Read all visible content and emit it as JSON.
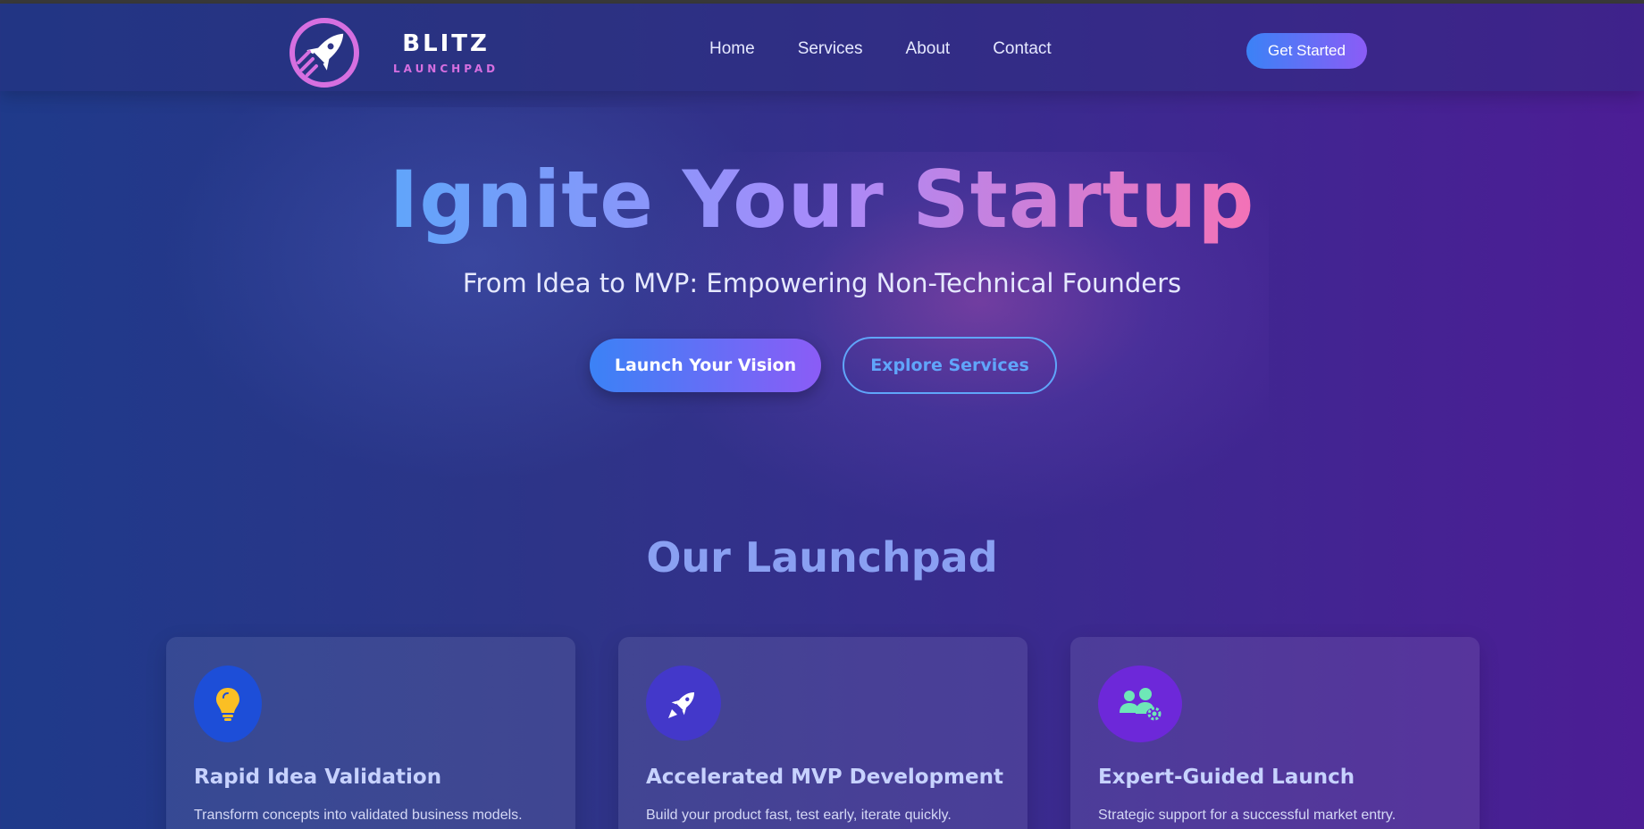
{
  "brand": {
    "name": "BLITZ",
    "tagline": "LAUNCHPAD"
  },
  "nav": {
    "items": [
      {
        "label": "Home"
      },
      {
        "label": "Services"
      },
      {
        "label": "About"
      },
      {
        "label": "Contact"
      }
    ],
    "cta_label": "Get Started"
  },
  "hero": {
    "title": "Ignite Your Startup",
    "subtitle": "From Idea to MVP: Empowering Non-Technical Founders",
    "primary_button": "Launch Your Vision",
    "secondary_button": "Explore Services"
  },
  "services": {
    "title": "Our Launchpad",
    "cards": [
      {
        "icon": "lightbulb-icon",
        "title": "Rapid Idea Validation",
        "description": "Transform concepts into validated business models.",
        "icon_bg": "#1d4ed8",
        "icon_color": "#fbbf24"
      },
      {
        "icon": "rocket-icon",
        "title": "Accelerated MVP Development",
        "description": "Build your product fast, test early, iterate quickly.",
        "icon_bg": "#4338ca",
        "icon_color": "#ffffff"
      },
      {
        "icon": "users-gear-icon",
        "title": "Expert-Guided Launch",
        "description": "Strategic support for a successful market entry.",
        "icon_bg": "#6d28d9",
        "icon_color": "#6ee7b7"
      }
    ]
  },
  "colors": {
    "accent_blue": "#3b82f6",
    "accent_purple": "#8b5cf6",
    "accent_pink": "#f472b6",
    "brand_magenta": "#d66fe0"
  }
}
